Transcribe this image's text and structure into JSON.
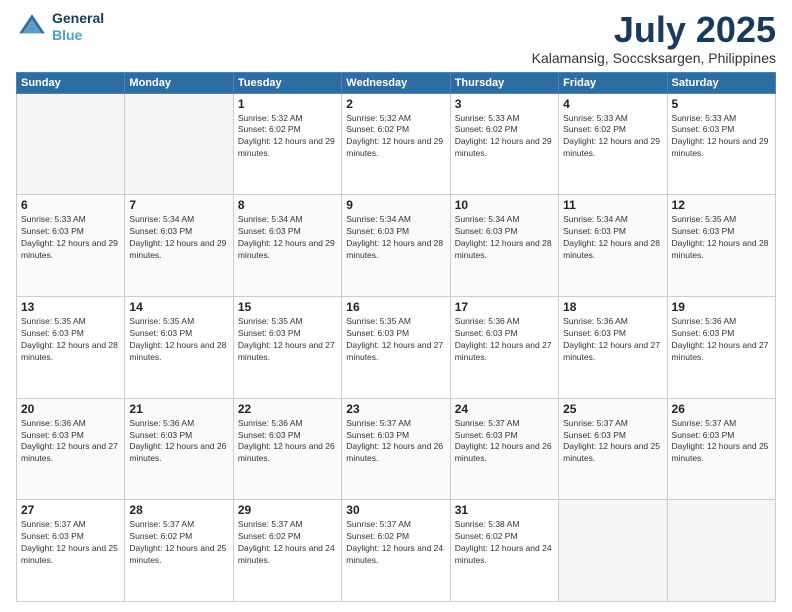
{
  "header": {
    "logo_line1": "General",
    "logo_line2": "Blue",
    "title": "July 2025",
    "subtitle": "Kalamansig, Soccsksargen, Philippines"
  },
  "weekdays": [
    "Sunday",
    "Monday",
    "Tuesday",
    "Wednesday",
    "Thursday",
    "Friday",
    "Saturday"
  ],
  "weeks": [
    [
      {
        "day": "",
        "info": ""
      },
      {
        "day": "",
        "info": ""
      },
      {
        "day": "1",
        "info": "Sunrise: 5:32 AM\nSunset: 6:02 PM\nDaylight: 12 hours and 29 minutes."
      },
      {
        "day": "2",
        "info": "Sunrise: 5:32 AM\nSunset: 6:02 PM\nDaylight: 12 hours and 29 minutes."
      },
      {
        "day": "3",
        "info": "Sunrise: 5:33 AM\nSunset: 6:02 PM\nDaylight: 12 hours and 29 minutes."
      },
      {
        "day": "4",
        "info": "Sunrise: 5:33 AM\nSunset: 6:02 PM\nDaylight: 12 hours and 29 minutes."
      },
      {
        "day": "5",
        "info": "Sunrise: 5:33 AM\nSunset: 6:03 PM\nDaylight: 12 hours and 29 minutes."
      }
    ],
    [
      {
        "day": "6",
        "info": "Sunrise: 5:33 AM\nSunset: 6:03 PM\nDaylight: 12 hours and 29 minutes."
      },
      {
        "day": "7",
        "info": "Sunrise: 5:34 AM\nSunset: 6:03 PM\nDaylight: 12 hours and 29 minutes."
      },
      {
        "day": "8",
        "info": "Sunrise: 5:34 AM\nSunset: 6:03 PM\nDaylight: 12 hours and 29 minutes."
      },
      {
        "day": "9",
        "info": "Sunrise: 5:34 AM\nSunset: 6:03 PM\nDaylight: 12 hours and 28 minutes."
      },
      {
        "day": "10",
        "info": "Sunrise: 5:34 AM\nSunset: 6:03 PM\nDaylight: 12 hours and 28 minutes."
      },
      {
        "day": "11",
        "info": "Sunrise: 5:34 AM\nSunset: 6:03 PM\nDaylight: 12 hours and 28 minutes."
      },
      {
        "day": "12",
        "info": "Sunrise: 5:35 AM\nSunset: 6:03 PM\nDaylight: 12 hours and 28 minutes."
      }
    ],
    [
      {
        "day": "13",
        "info": "Sunrise: 5:35 AM\nSunset: 6:03 PM\nDaylight: 12 hours and 28 minutes."
      },
      {
        "day": "14",
        "info": "Sunrise: 5:35 AM\nSunset: 6:03 PM\nDaylight: 12 hours and 28 minutes."
      },
      {
        "day": "15",
        "info": "Sunrise: 5:35 AM\nSunset: 6:03 PM\nDaylight: 12 hours and 27 minutes."
      },
      {
        "day": "16",
        "info": "Sunrise: 5:35 AM\nSunset: 6:03 PM\nDaylight: 12 hours and 27 minutes."
      },
      {
        "day": "17",
        "info": "Sunrise: 5:36 AM\nSunset: 6:03 PM\nDaylight: 12 hours and 27 minutes."
      },
      {
        "day": "18",
        "info": "Sunrise: 5:36 AM\nSunset: 6:03 PM\nDaylight: 12 hours and 27 minutes."
      },
      {
        "day": "19",
        "info": "Sunrise: 5:36 AM\nSunset: 6:03 PM\nDaylight: 12 hours and 27 minutes."
      }
    ],
    [
      {
        "day": "20",
        "info": "Sunrise: 5:36 AM\nSunset: 6:03 PM\nDaylight: 12 hours and 27 minutes."
      },
      {
        "day": "21",
        "info": "Sunrise: 5:36 AM\nSunset: 6:03 PM\nDaylight: 12 hours and 26 minutes."
      },
      {
        "day": "22",
        "info": "Sunrise: 5:36 AM\nSunset: 6:03 PM\nDaylight: 12 hours and 26 minutes."
      },
      {
        "day": "23",
        "info": "Sunrise: 5:37 AM\nSunset: 6:03 PM\nDaylight: 12 hours and 26 minutes."
      },
      {
        "day": "24",
        "info": "Sunrise: 5:37 AM\nSunset: 6:03 PM\nDaylight: 12 hours and 26 minutes."
      },
      {
        "day": "25",
        "info": "Sunrise: 5:37 AM\nSunset: 6:03 PM\nDaylight: 12 hours and 25 minutes."
      },
      {
        "day": "26",
        "info": "Sunrise: 5:37 AM\nSunset: 6:03 PM\nDaylight: 12 hours and 25 minutes."
      }
    ],
    [
      {
        "day": "27",
        "info": "Sunrise: 5:37 AM\nSunset: 6:03 PM\nDaylight: 12 hours and 25 minutes."
      },
      {
        "day": "28",
        "info": "Sunrise: 5:37 AM\nSunset: 6:02 PM\nDaylight: 12 hours and 25 minutes."
      },
      {
        "day": "29",
        "info": "Sunrise: 5:37 AM\nSunset: 6:02 PM\nDaylight: 12 hours and 24 minutes."
      },
      {
        "day": "30",
        "info": "Sunrise: 5:37 AM\nSunset: 6:02 PM\nDaylight: 12 hours and 24 minutes."
      },
      {
        "day": "31",
        "info": "Sunrise: 5:38 AM\nSunset: 6:02 PM\nDaylight: 12 hours and 24 minutes."
      },
      {
        "day": "",
        "info": ""
      },
      {
        "day": "",
        "info": ""
      }
    ]
  ]
}
